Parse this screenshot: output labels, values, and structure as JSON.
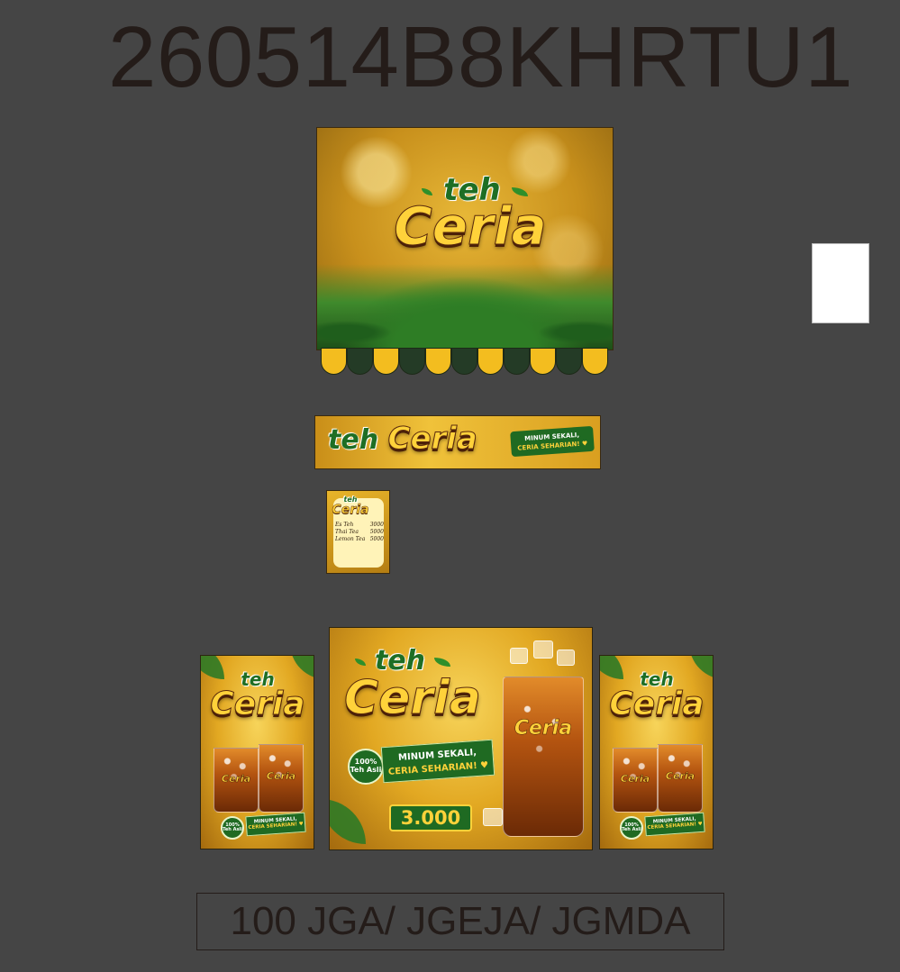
{
  "header": {
    "code": "260514B8KHRTU1"
  },
  "brand": {
    "teh": "teh",
    "ceria": "Ceria"
  },
  "slogan": {
    "line1": "MINUM SEKALI,",
    "line2": "CERIA SEHARIAN! ♥"
  },
  "menu": {
    "items": [
      {
        "name": "Es Teh",
        "price": "3000"
      },
      {
        "name": "Thai Tea",
        "price": "5000"
      },
      {
        "name": "Lemon Tea",
        "price": "5000"
      }
    ]
  },
  "center_poster": {
    "badge_line1": "100%",
    "badge_line2": "Teh Asli",
    "price": "3.000"
  },
  "side_poster": {
    "badge_line1": "100%",
    "badge_line2": "Teh Asli"
  },
  "footer": {
    "text": "100 JGA/ JGEJA/ JGMDA"
  },
  "colors": {
    "background": "#454545",
    "brand_yellow": "#ffd23a",
    "brand_green": "#1f6a22",
    "brand_brown": "#5a2a0c"
  },
  "icons": [
    "leaf-icon",
    "heart-icon"
  ]
}
